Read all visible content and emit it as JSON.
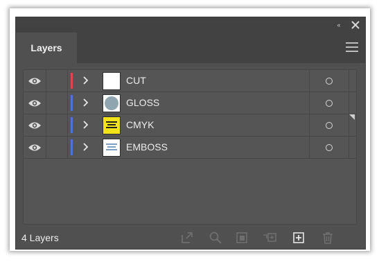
{
  "panel": {
    "tab_label": "Layers",
    "collapse_glyph": "«",
    "layer_count": "4 Layers"
  },
  "layers": [
    {
      "name": "CUT",
      "color": "#e0454a",
      "thumb": "white",
      "visible": true
    },
    {
      "name": "GLOSS",
      "color": "#4a74d6",
      "thumb": "gray-circle",
      "visible": true
    },
    {
      "name": "CMYK",
      "color": "#4a74d6",
      "thumb": "yellow-artwork",
      "visible": true
    },
    {
      "name": "EMBOSS",
      "color": "#4a74d6",
      "thumb": "blue-artwork",
      "visible": true
    }
  ],
  "footer_tools": [
    "export-icon",
    "locate-object-icon",
    "make-clipping-mask-icon",
    "create-sublayer-icon",
    "new-layer-icon",
    "delete-icon"
  ],
  "colors": {
    "panel_bg": "#505050",
    "header_bg": "#424242",
    "text": "#ececec"
  }
}
